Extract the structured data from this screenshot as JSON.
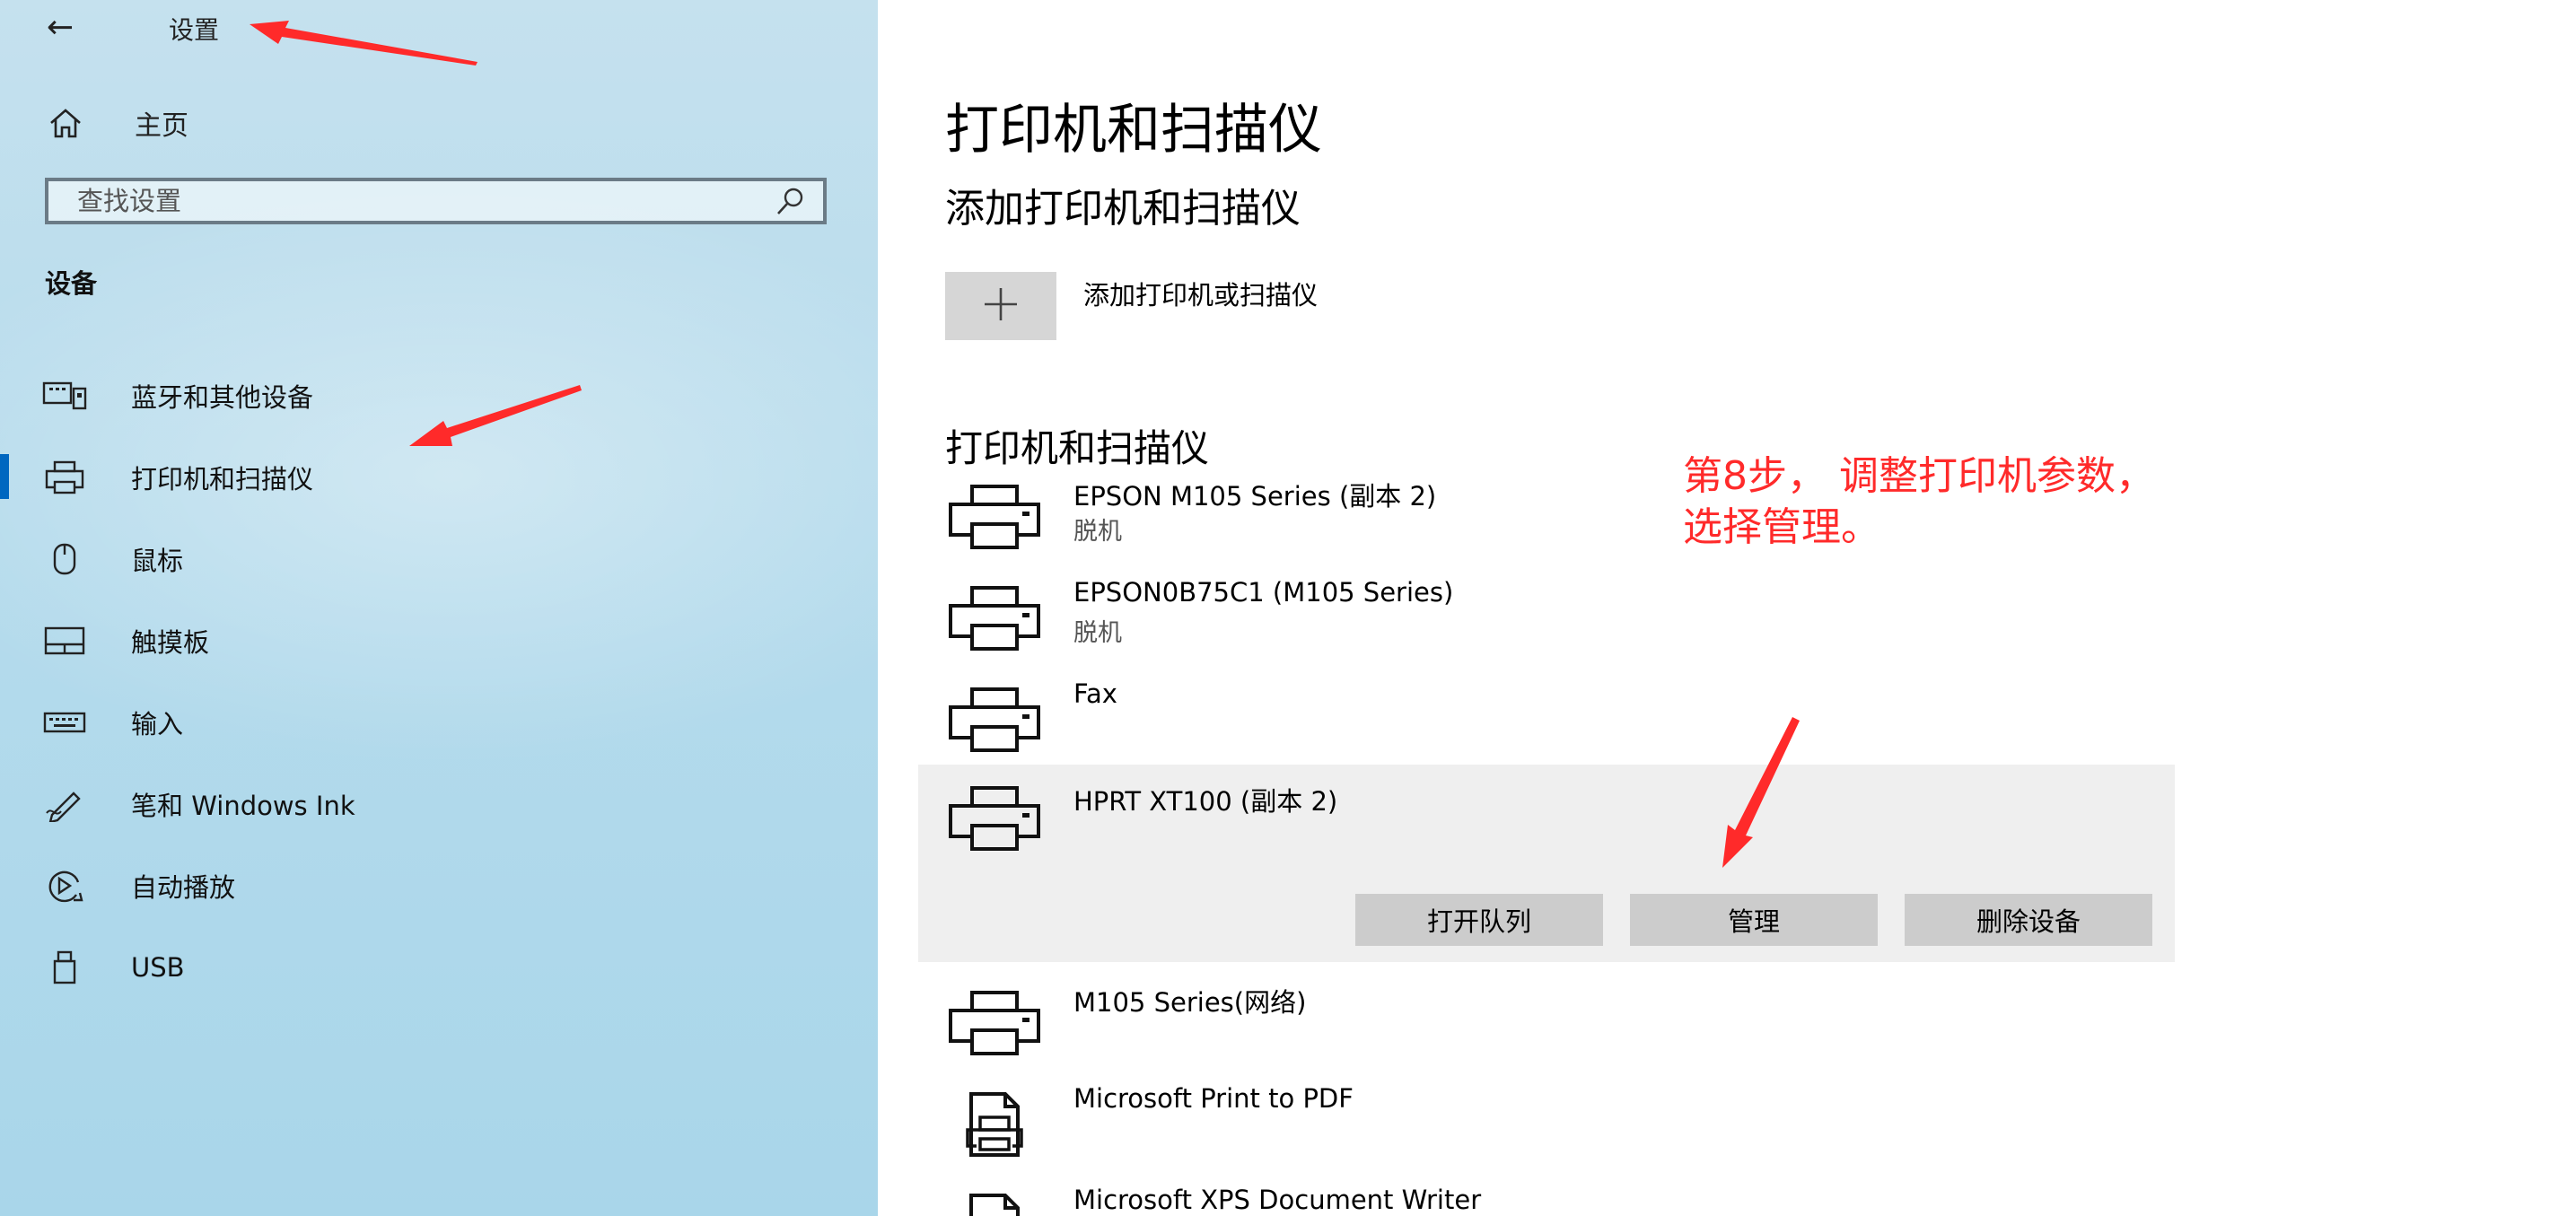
{
  "window": {
    "back_label": "←",
    "title": "设置"
  },
  "sidebar": {
    "home_label": "主页",
    "search_placeholder": "查找设置",
    "section": "设备",
    "items": [
      {
        "label": "蓝牙和其他设备",
        "icon": "bluetooth-devices-icon"
      },
      {
        "label": "打印机和扫描仪",
        "icon": "printer-icon",
        "selected": true
      },
      {
        "label": "鼠标",
        "icon": "mouse-icon"
      },
      {
        "label": "触摸板",
        "icon": "touchpad-icon"
      },
      {
        "label": "输入",
        "icon": "keyboard-icon"
      },
      {
        "label": "笔和 Windows Ink",
        "icon": "pen-icon"
      },
      {
        "label": "自动播放",
        "icon": "autoplay-icon"
      },
      {
        "label": "USB",
        "icon": "usb-icon"
      }
    ]
  },
  "main": {
    "title": "打印机和扫描仪",
    "add_section_title": "添加打印机和扫描仪",
    "add_button_label": "添加打印机或扫描仪",
    "list_title": "打印机和扫描仪",
    "printers": [
      {
        "name": "EPSON M105 Series (副本 2)",
        "status": "脱机",
        "icon": "printer-icon"
      },
      {
        "name": "EPSON0B75C1 (M105 Series)",
        "status": "脱机",
        "icon": "printer-icon"
      },
      {
        "name": "Fax",
        "status": "",
        "icon": "printer-icon"
      },
      {
        "name": "HPRT XT100 (副本 2)",
        "status": "",
        "icon": "printer-icon",
        "expanded": true
      },
      {
        "name": "M105 Series(网络)",
        "status": "",
        "icon": "printer-icon"
      },
      {
        "name": "Microsoft Print to PDF",
        "status": "",
        "icon": "pdf-printer-icon"
      },
      {
        "name": "Microsoft XPS Document Writer",
        "status": "",
        "icon": "xps-printer-icon"
      }
    ],
    "actions": {
      "open_queue": "打开队列",
      "manage": "管理",
      "remove": "删除设备"
    }
  },
  "annotation": {
    "line1": "第8步， 调整打印机参数，",
    "line2": "选择管理。"
  },
  "colors": {
    "accent": "#0067c0",
    "annotation": "#ff2a2a",
    "sidebar": "#b5dbec"
  }
}
